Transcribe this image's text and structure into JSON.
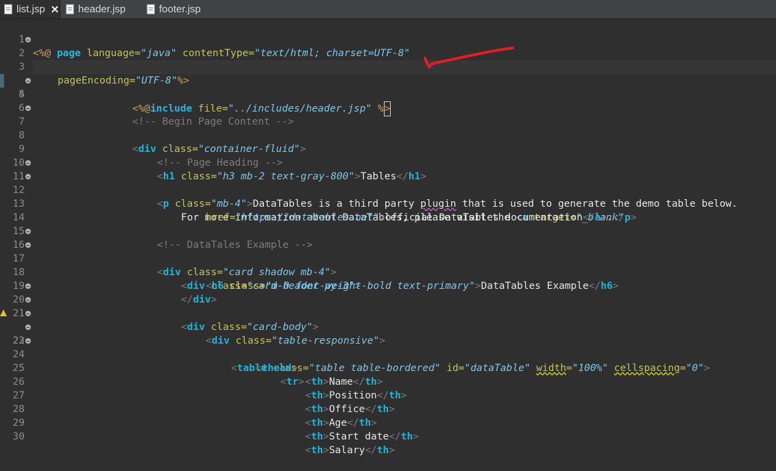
{
  "tabs": [
    {
      "label": "list.jsp",
      "active": true,
      "closable": true
    },
    {
      "label": "header.jsp",
      "active": false
    },
    {
      "label": "footer.jsp",
      "active": false
    }
  ],
  "lines": [
    {
      "n": "1",
      "fold": false
    },
    {
      "n": "2",
      "fold": true
    },
    {
      "n": "3",
      "fold": false
    },
    {
      "n": "4",
      "fold": false
    },
    {
      "n": "5",
      "fold": true
    },
    {
      "n": "6",
      "fold": false
    },
    {
      "n": "7",
      "fold": true
    },
    {
      "n": "8",
      "fold": false
    },
    {
      "n": "9",
      "fold": false
    },
    {
      "n": "10",
      "fold": false
    },
    {
      "n": "11",
      "fold": true
    },
    {
      "n": "12",
      "fold": true
    },
    {
      "n": "13",
      "fold": false
    },
    {
      "n": "14",
      "fold": false
    },
    {
      "n": "15",
      "fold": false
    },
    {
      "n": "16",
      "fold": true
    },
    {
      "n": "17",
      "fold": true
    },
    {
      "n": "18",
      "fold": false
    },
    {
      "n": "19",
      "fold": false
    },
    {
      "n": "20",
      "fold": true
    },
    {
      "n": "21",
      "fold": true
    },
    {
      "n": "22",
      "fold": true
    },
    {
      "n": "23",
      "fold": true
    },
    {
      "n": "24",
      "fold": true
    },
    {
      "n": "25",
      "fold": false
    },
    {
      "n": "26",
      "fold": false
    },
    {
      "n": "27",
      "fold": false
    },
    {
      "n": "28",
      "fold": false
    },
    {
      "n": "29",
      "fold": false
    },
    {
      "n": "30",
      "fold": false
    }
  ],
  "code": {
    "l1_open": "<%@",
    "l1_page": "page",
    "l1_lang_attr": "language=",
    "l1_lang_val": "\"java\"",
    "l1_ct_attr": "contentType=",
    "l1_ct_val": "\"text/html; charset=UTF-8\"",
    "l2_pe_attr": "pageEncoding=",
    "l2_pe_val": "\"UTF-8\"",
    "l2_close": "%>",
    "l4_open": "<%@",
    "l4_include": "include",
    "l4_file_attr": "file=",
    "l4_file_val": "\"../includes/header.jsp\"",
    "l4_close_pct": "%",
    "l4_close_gt": ">",
    "l6_comment": "<!-- Begin Page Content -->",
    "l7_lt": "<",
    "l7_tag": "div",
    "l7_attr": "class=",
    "l7_val": "\"container-fluid\"",
    "l7_gt": ">",
    "l9_comment": "<!-- Page Heading -->",
    "l10_tag": "h1",
    "l10_attr": "class=",
    "l10_val": "\"h3 mb-2 text-gray-800\"",
    "l10_text": "Tables",
    "l10_ctag": "h1",
    "l11_tag": "p",
    "l11_attr": "class=",
    "l11_val": "\"mb-4\"",
    "l11_text_a": "DataTables is a third party ",
    "l11_text_plugin": "plugin",
    "l11_text_b": " that is used to generate the demo table below.",
    "l12_text": "For more information about DataTables, please visit the ",
    "l12_tag": "a",
    "l12_attr": "target=",
    "l12_val": "\"_blank\"",
    "l13_attr": "href=",
    "l13_val": "\"https://datatables.net\"",
    "l13_text": "official DataTables documentation",
    "l13_ctag_a": "a",
    "l13_dot": ".",
    "l13_ctag_p": "p",
    "l15_comment": "<!-- DataTales Example -->",
    "l16_tag": "div",
    "l16_attr": "class=",
    "l16_val": "\"card shadow mb-4\"",
    "l17_tag": "div",
    "l17_attr": "class=",
    "l17_val": "\"card-header py-3\"",
    "l18_tag": "h6",
    "l18_attr": "class=",
    "l18_val": "\"m-0 font-weight-bold text-primary\"",
    "l18_text": "DataTables Example",
    "l18_ctag": "h6",
    "l19_ctag": "div",
    "l20_tag": "div",
    "l20_attr": "class=",
    "l20_val": "\"card-body\"",
    "l21_tag": "div",
    "l21_attr": "class=",
    "l21_val": "\"table-responsive\"",
    "l22_tag": "table",
    "l22_attr1": "class=",
    "l22_val1": "\"table table-bordered\"",
    "l22_attr2": "id=",
    "l22_val2": "\"dataTable\"",
    "l22_attr3": "width",
    "l22_eq3": "=",
    "l22_val3": "\"100%\"",
    "l22_attr4": "cellspacing",
    "l22_eq4": "=",
    "l22_val4": "\"0\"",
    "l23_tag": "thead",
    "l24_tag": "tr",
    "th_tag": "th",
    "th_values": [
      "Name",
      "Position",
      "Office",
      "Age",
      "Start date",
      "Salary"
    ]
  }
}
